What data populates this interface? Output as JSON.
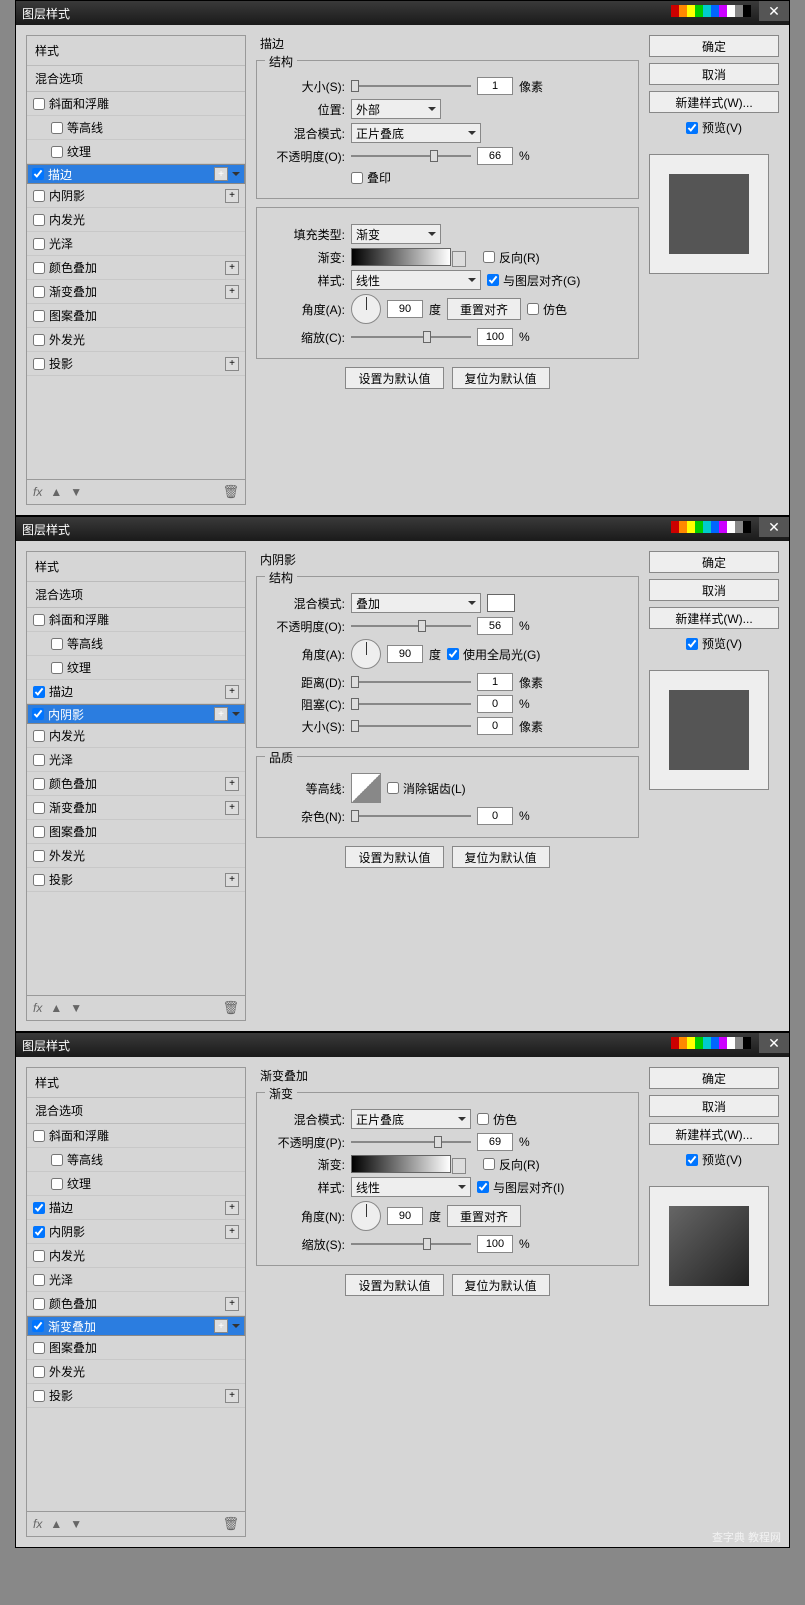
{
  "dialog_title": "图层样式",
  "sidebar": {
    "styles_label": "样式",
    "blend_label": "混合选项",
    "items": [
      {
        "label": "斜面和浮雕",
        "plus": false
      },
      {
        "label": "等高线",
        "indent": true
      },
      {
        "label": "纹理",
        "indent": true
      },
      {
        "label": "描边",
        "plus": true
      },
      {
        "label": "内阴影",
        "plus": true
      },
      {
        "label": "内发光"
      },
      {
        "label": "光泽"
      },
      {
        "label": "颜色叠加",
        "plus": true
      },
      {
        "label": "渐变叠加",
        "plus": true
      },
      {
        "label": "图案叠加"
      },
      {
        "label": "外发光"
      },
      {
        "label": "投影",
        "plus": true
      }
    ],
    "fx": "fx"
  },
  "buttons": {
    "ok": "确定",
    "cancel": "取消",
    "newstyle": "新建样式(W)...",
    "preview": "预览(V)",
    "setdefault": "设置为默认值",
    "resetdefault": "复位为默认值",
    "resetalign": "重置对齐"
  },
  "d1": {
    "title": "描边",
    "group1": "结构",
    "size_l": "大小(S):",
    "size_v": "1",
    "size_u": "像素",
    "pos_l": "位置:",
    "pos_v": "外部",
    "blend_l": "混合模式:",
    "blend_v": "正片叠底",
    "opac_l": "不透明度(O):",
    "opac_v": "66",
    "pct": "%",
    "overprint": "叠印",
    "filltype_l": "填充类型:",
    "filltype_v": "渐变",
    "grad_l": "渐变:",
    "reverse": "反向(R)",
    "style_l": "样式:",
    "style_v": "线性",
    "align": "与图层对齐(G)",
    "angle_l": "角度(A):",
    "angle_v": "90",
    "deg": "度",
    "dither": "仿色",
    "scale_l": "缩放(C):",
    "scale_v": "100"
  },
  "d2": {
    "title": "内阴影",
    "group1": "结构",
    "group2": "品质",
    "blend_l": "混合模式:",
    "blend_v": "叠加",
    "opac_l": "不透明度(O):",
    "opac_v": "56",
    "pct": "%",
    "angle_l": "角度(A):",
    "angle_v": "90",
    "deg": "度",
    "global": "使用全局光(G)",
    "dist_l": "距离(D):",
    "dist_v": "1",
    "px": "像素",
    "choke_l": "阻塞(C):",
    "choke_v": "0",
    "size_l": "大小(S):",
    "size_v": "0",
    "contour_l": "等高线:",
    "anti": "消除锯齿(L)",
    "noise_l": "杂色(N):",
    "noise_v": "0"
  },
  "d3": {
    "title": "渐变叠加",
    "group1": "渐变",
    "blend_l": "混合模式:",
    "blend_v": "正片叠底",
    "dither": "仿色",
    "opac_l": "不透明度(P):",
    "opac_v": "69",
    "pct": "%",
    "grad_l": "渐变:",
    "reverse": "反向(R)",
    "style_l": "样式:",
    "style_v": "线性",
    "align": "与图层对齐(I)",
    "angle_l": "角度(N):",
    "angle_v": "90",
    "deg": "度",
    "scale_l": "缩放(S):",
    "scale_v": "100"
  },
  "watermark": "查字典 教程网"
}
